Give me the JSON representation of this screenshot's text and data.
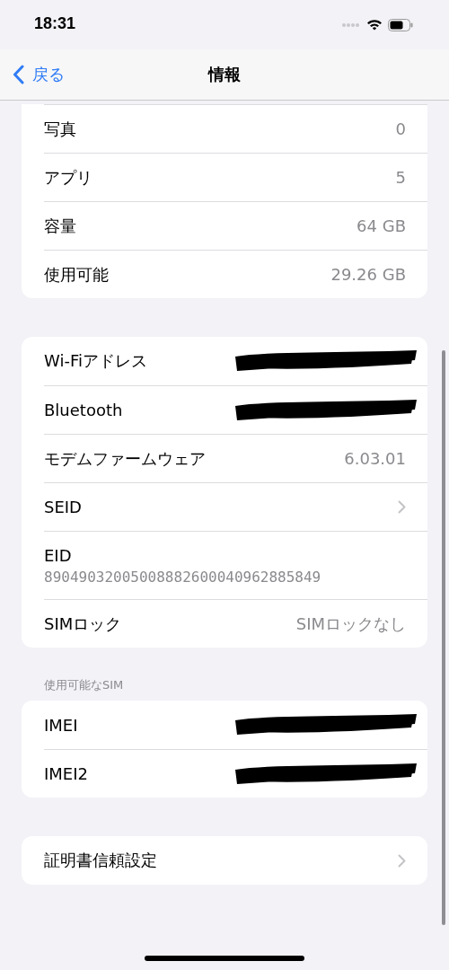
{
  "status_bar": {
    "time": "18:31"
  },
  "nav": {
    "back": "戻る",
    "title": "情報"
  },
  "sections": [
    {
      "cut_top": true,
      "rows": [
        {
          "kind": "value",
          "label": "写真",
          "value": "0"
        },
        {
          "kind": "value",
          "label": "アプリ",
          "value": "5"
        },
        {
          "kind": "value",
          "label": "容量",
          "value": "64 GB"
        },
        {
          "kind": "value",
          "label": "使用可能",
          "value": "29.26 GB"
        }
      ]
    },
    {
      "rows": [
        {
          "kind": "redacted",
          "label": "Wi-Fiアドレス"
        },
        {
          "kind": "redacted",
          "label": "Bluetooth"
        },
        {
          "kind": "value",
          "label": "モデムファームウェア",
          "value": "6.03.01"
        },
        {
          "kind": "chevron",
          "label": "SEID"
        },
        {
          "kind": "stacked",
          "label": "EID",
          "value": "89049032005008882600040962885849"
        },
        {
          "kind": "value",
          "label": "SIMロック",
          "value": "SIMロックなし"
        }
      ]
    },
    {
      "header": "使用可能なSIM",
      "rows": [
        {
          "kind": "redacted",
          "label": "IMEI"
        },
        {
          "kind": "redacted",
          "label": "IMEI2"
        }
      ]
    },
    {
      "rows": [
        {
          "kind": "chevron",
          "label": "証明書信頼設定"
        }
      ]
    }
  ]
}
